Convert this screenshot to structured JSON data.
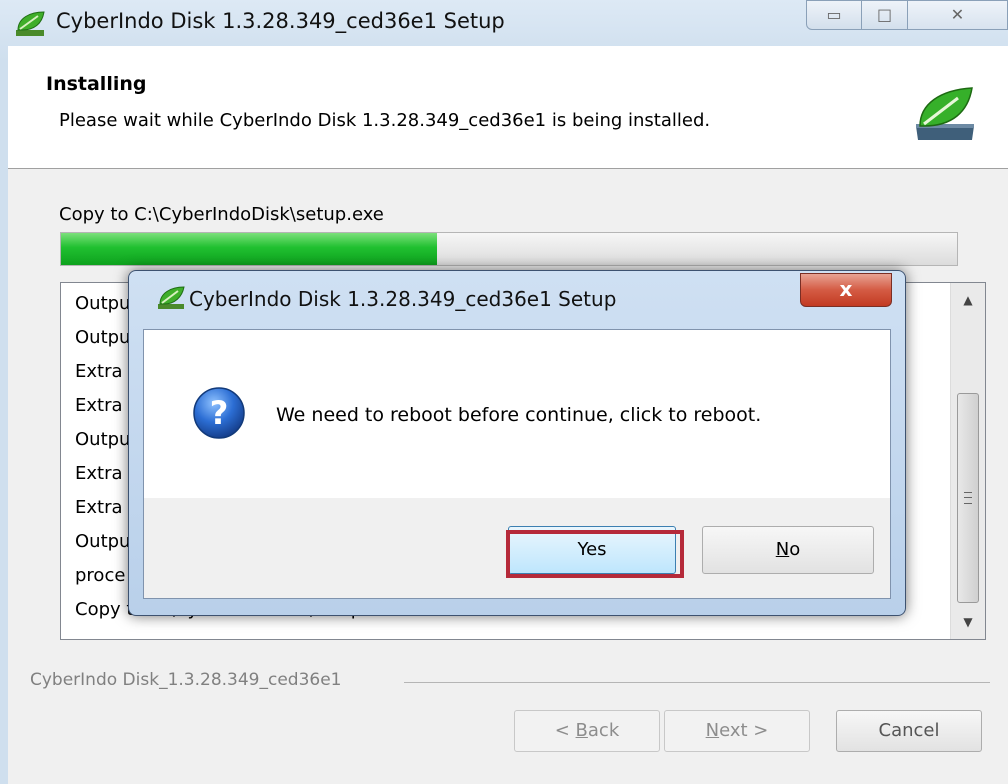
{
  "window": {
    "title": "CyberIndo Disk 1.3.28.349_ced36e1 Setup",
    "controls": {
      "minimize": "▭",
      "maximize": "□",
      "close": "✕"
    }
  },
  "header": {
    "title": "Installing",
    "subtitle": "Please wait while CyberIndo Disk 1.3.28.349_ced36e1 is being installed."
  },
  "progress": {
    "status": "Copy to C:\\CyberIndoDisk\\setup.exe",
    "percent": 42
  },
  "log": {
    "lines": [
      "Outpu",
      "Outpu",
      "Extra",
      "Extra",
      "Outpu",
      "Extra",
      "Extra",
      "Outpu",
      "proce",
      "Copy to C:\\CyberIndoDisk\\setup.exe"
    ]
  },
  "footer": {
    "brand": "CyberIndo Disk_1.3.28.349_ced36e1",
    "back_prefix": "< ",
    "back_key": "B",
    "back_rest": "ack",
    "next_key": "N",
    "next_rest": "ext >",
    "cancel": "Cancel"
  },
  "dialog": {
    "title": "CyberIndo Disk 1.3.28.349_ced36e1 Setup",
    "close": "x",
    "message": "We need to reboot before continue, click to reboot.",
    "yes": "Yes",
    "no_key": "N",
    "no_rest": "o"
  },
  "colors": {
    "accent_green": "#20c030",
    "highlight_red": "#b52a3a"
  },
  "icons": {
    "app": "leaf-icon",
    "header": "leaf-disk-icon",
    "question": "question-icon"
  }
}
